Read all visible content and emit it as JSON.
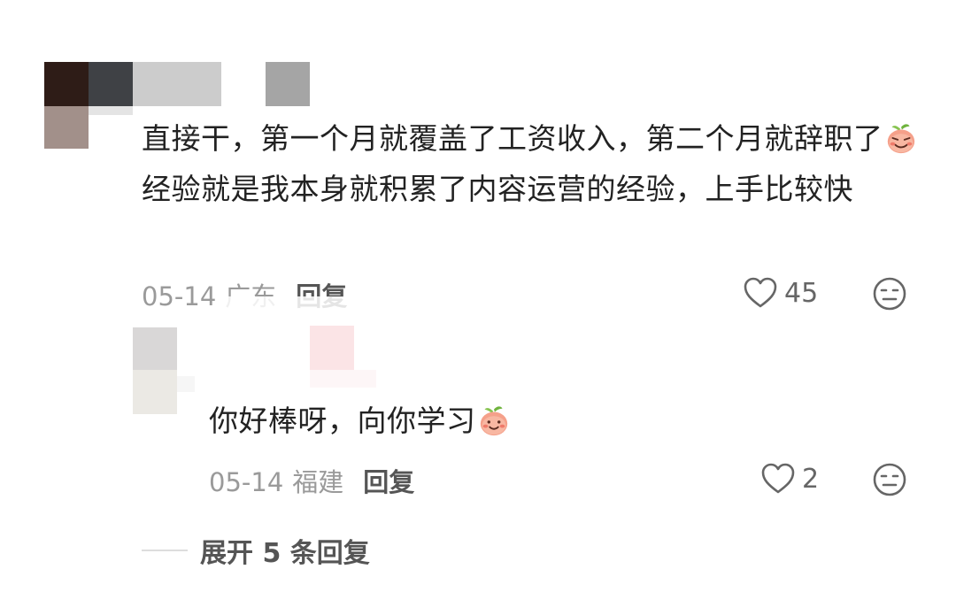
{
  "comment": {
    "text_part1": "直接干，第一个月就覆盖了工资收入，第二个月就辞职了",
    "text_part2": "经验就是我本身就积累了内容运营的经验，上手比较快",
    "emoji_icon": "peach-face-emoji",
    "date": "05-14",
    "region": "广东",
    "reply_label": "回复",
    "like_count": "45"
  },
  "reply": {
    "text": "你好棒呀，向你学习",
    "emoji_icon": "peach-smile-emoji",
    "date": "05-14",
    "region": "福建",
    "reply_label": "回复",
    "like_count": "2"
  },
  "expand": {
    "label": "展开 5 条回复"
  },
  "colors": {
    "text": "#222222",
    "meta": "#9a9a9a",
    "icon": "#666666"
  }
}
